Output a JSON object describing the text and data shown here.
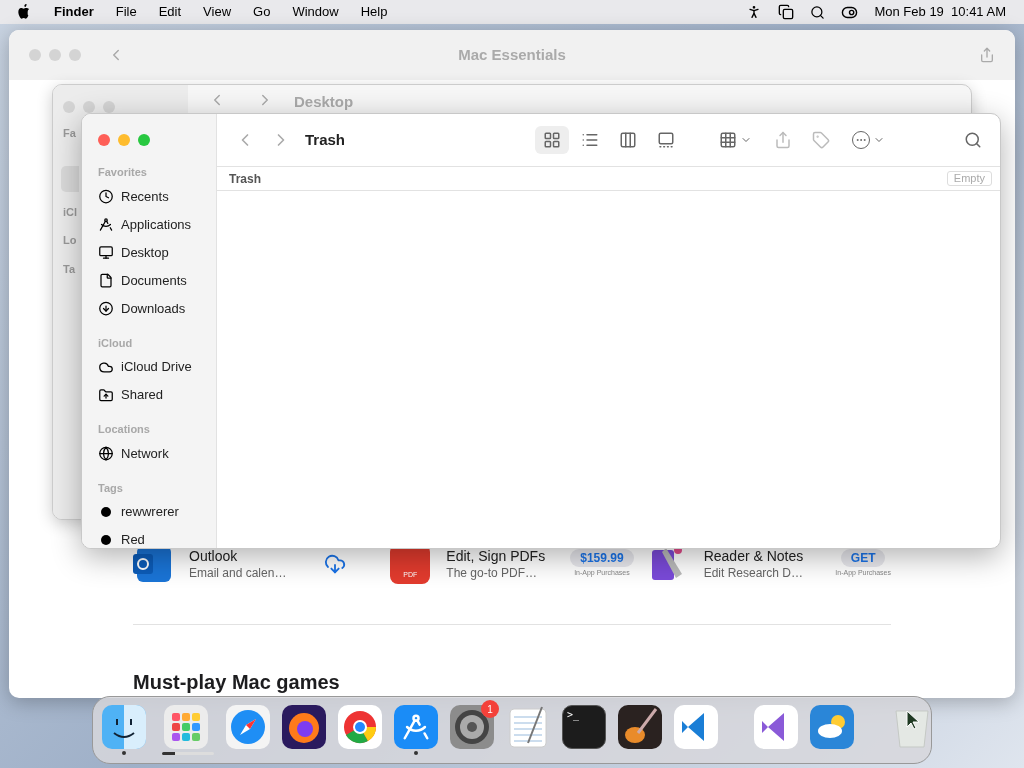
{
  "menu_bar": {
    "app": "Finder",
    "menus": [
      "File",
      "Edit",
      "View",
      "Go",
      "Window",
      "Help"
    ],
    "clock": "Mon Feb 19  10:41 AM"
  },
  "store_window": {
    "title": "Mac Essentials",
    "apps": [
      {
        "title": "Outlook",
        "subtitle": "Email and calen…"
      },
      {
        "title": "Edit, Sign PDFs",
        "subtitle": "The go-to PDF…",
        "icon_label": "PDF",
        "price": "$159.99",
        "note": "In-App Purchases"
      },
      {
        "title": "Reader & Notes",
        "subtitle": "Edit Research D…",
        "price": "GET",
        "note": "In-App Purchases"
      }
    ],
    "heading": "Must-play Mac games"
  },
  "back_window": {
    "title": "Desktop",
    "sidebar_fragments": [
      "Fa",
      "iCl",
      "Lo",
      "Ta"
    ]
  },
  "finder": {
    "title": "Trash",
    "views": [
      {
        "selected": true
      },
      {
        "selected": false
      },
      {
        "selected": false
      },
      {
        "selected": false
      }
    ],
    "sidebar": [
      {
        "heading": "Favorites",
        "items": [
          {
            "kind": "location",
            "label": "Recents"
          },
          {
            "kind": "location",
            "label": "Applications"
          },
          {
            "kind": "location",
            "label": "Desktop"
          },
          {
            "kind": "location",
            "label": "Documents"
          },
          {
            "kind": "location",
            "label": "Downloads"
          }
        ]
      },
      {
        "heading": "iCloud",
        "items": [
          {
            "kind": "location",
            "label": "iCloud Drive"
          },
          {
            "kind": "location",
            "label": "Shared"
          }
        ]
      },
      {
        "heading": "Locations",
        "items": [
          {
            "kind": "location",
            "label": "Network"
          }
        ]
      },
      {
        "heading": "Tags",
        "items": [
          {
            "kind": "tag",
            "label": "rewwrerer",
            "color": "#000000"
          },
          {
            "kind": "tag",
            "label": "Red",
            "color": "#000000"
          }
        ]
      }
    ],
    "path": "Trash",
    "empty_button": {
      "label": "Empty",
      "disabled": true
    }
  },
  "dock": {
    "items": [
      {
        "running": true
      },
      {
        "running": false,
        "level": 0.25
      },
      {
        "running": false
      },
      {
        "running": false
      },
      {
        "running": false
      },
      {
        "running": true
      },
      {
        "running": false,
        "badge": "1"
      },
      {
        "running": false
      },
      {
        "running": false,
        "prompt": ">_"
      },
      {
        "running": false
      },
      {
        "running": false
      },
      {
        "running": false
      },
      {
        "running": false
      },
      {
        "running": false
      }
    ]
  }
}
